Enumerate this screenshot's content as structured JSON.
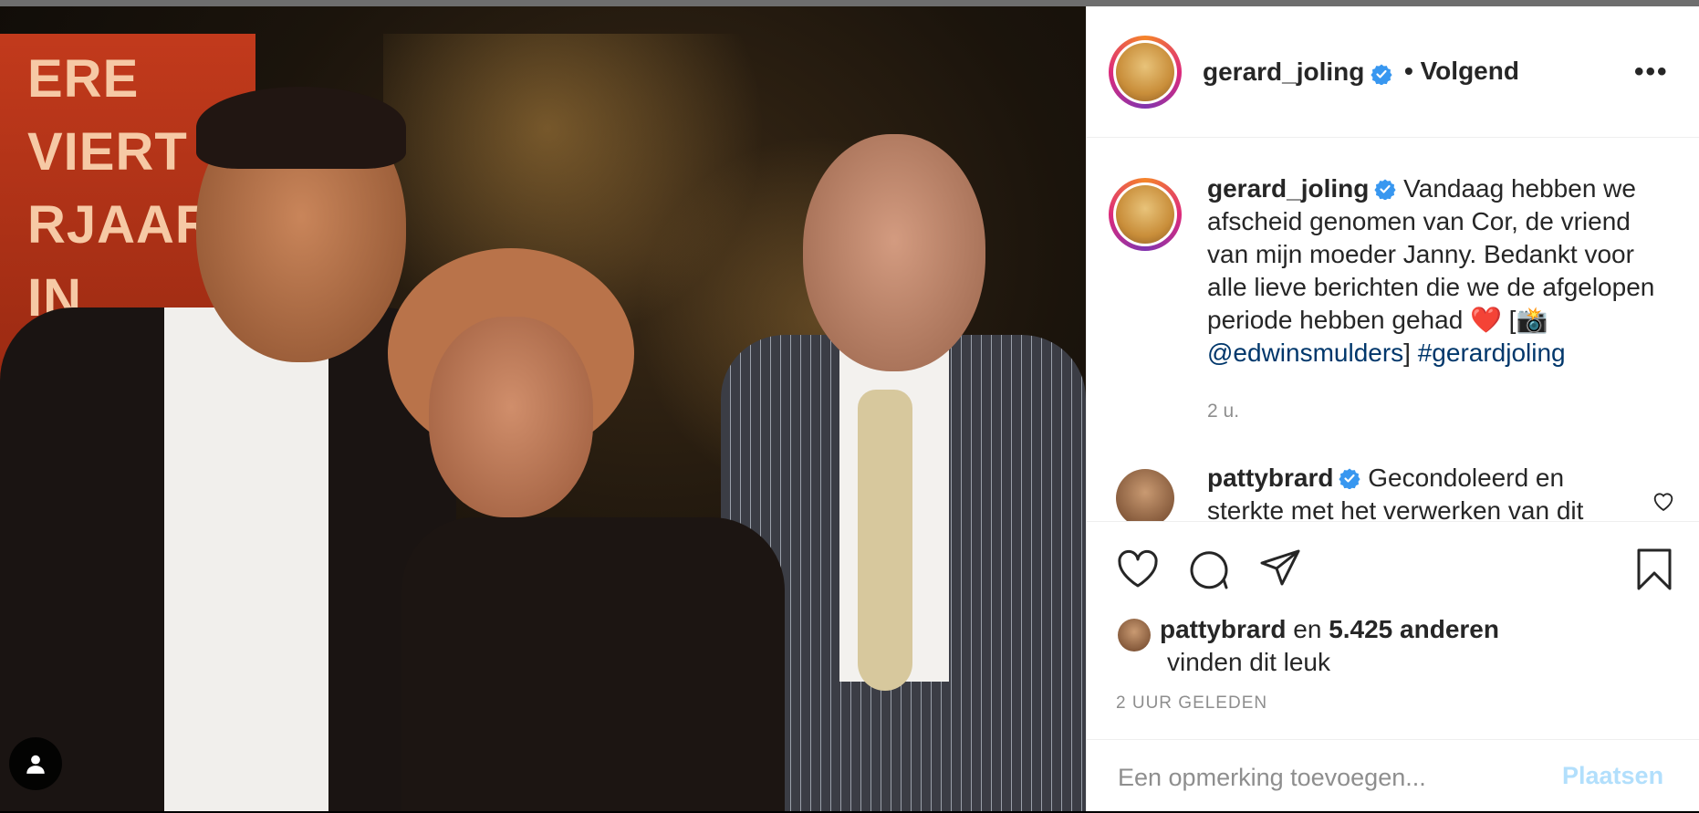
{
  "post": {
    "username": "gerard_joling",
    "follow_status": "• Volgend",
    "more_icon": "more-horizontal-icon"
  },
  "caption": {
    "username": "gerard_joling",
    "text": "Vandaag hebben we afscheid genomen van Cor, de vriend van mijn moeder Janny. Bedankt voor alle lieve berichten die we de afgelopen periode hebben gehad ❤️  [📸 ",
    "mention": "@edwinsmulders",
    "after_mention": "] ",
    "hashtag": "#gerardjoling",
    "time": "2 u."
  },
  "comment": {
    "username": "pattybrard",
    "text": "Gecondoleerd en sterkte met het verwerken van dit verlies"
  },
  "likes": {
    "user": "pattybrard",
    "connector": "en",
    "count_text": "5.425 anderen",
    "suffix": "vinden dit leuk"
  },
  "posted": "2 UUR GELEDEN",
  "add_comment": {
    "placeholder": "Een opmerking toevoegen...",
    "post_label": "Plaatsen"
  },
  "photo_poster_text": "ERE\nVIERT\nRJAARDA\nIN\nCA",
  "colors": {
    "link": "#00376b",
    "verified": "#3897f0",
    "post_button_disabled": "#b2dffc",
    "muted": "#8e8e8e"
  }
}
